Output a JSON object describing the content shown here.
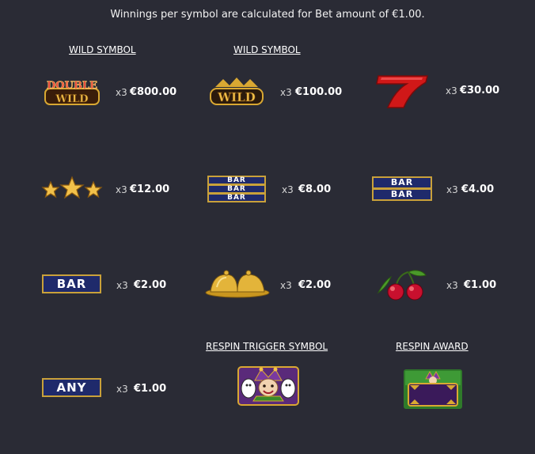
{
  "intro": "Winnings per symbol are calculated for Bet amount of €1.00.",
  "headings": {
    "wild1": "WILD SYMBOL",
    "wild2": "WILD SYMBOL",
    "respin_trigger": "RESPIN TRIGGER SYMBOL",
    "respin_award": "RESPIN AWARD"
  },
  "symbols": [
    {
      "name": "double-wild",
      "label": "DOUBLE WILD",
      "mult": "x3",
      "amount": "€800.00"
    },
    {
      "name": "wild",
      "label": "WILD",
      "mult": "x3",
      "amount": "€100.00"
    },
    {
      "name": "seven",
      "label": "7",
      "mult": "x3",
      "amount": "€30.00"
    },
    {
      "name": "three-stars",
      "label": "",
      "mult": "x3",
      "amount": "€12.00"
    },
    {
      "name": "triple-bar",
      "label": "BAR",
      "mult": "x3",
      "amount": "€8.00"
    },
    {
      "name": "double-bar",
      "label": "BAR",
      "mult": "x3",
      "amount": "€4.00"
    },
    {
      "name": "single-bar",
      "label": "BAR",
      "mult": "x3",
      "amount": "€2.00"
    },
    {
      "name": "bells",
      "label": "",
      "mult": "x3",
      "amount": "€2.00"
    },
    {
      "name": "cherries",
      "label": "",
      "mult": "x3",
      "amount": "€1.00"
    },
    {
      "name": "any-bar",
      "label": "ANY",
      "mult": "x3",
      "amount": "€1.00"
    }
  ],
  "colors": {
    "background": "#2a2b35",
    "bar_blue": "#1f2a6b",
    "gold": "#c9a13a",
    "seven_red": "#d01818",
    "cherry_red": "#c8102e",
    "jester_purple": "#6a2a8a"
  }
}
